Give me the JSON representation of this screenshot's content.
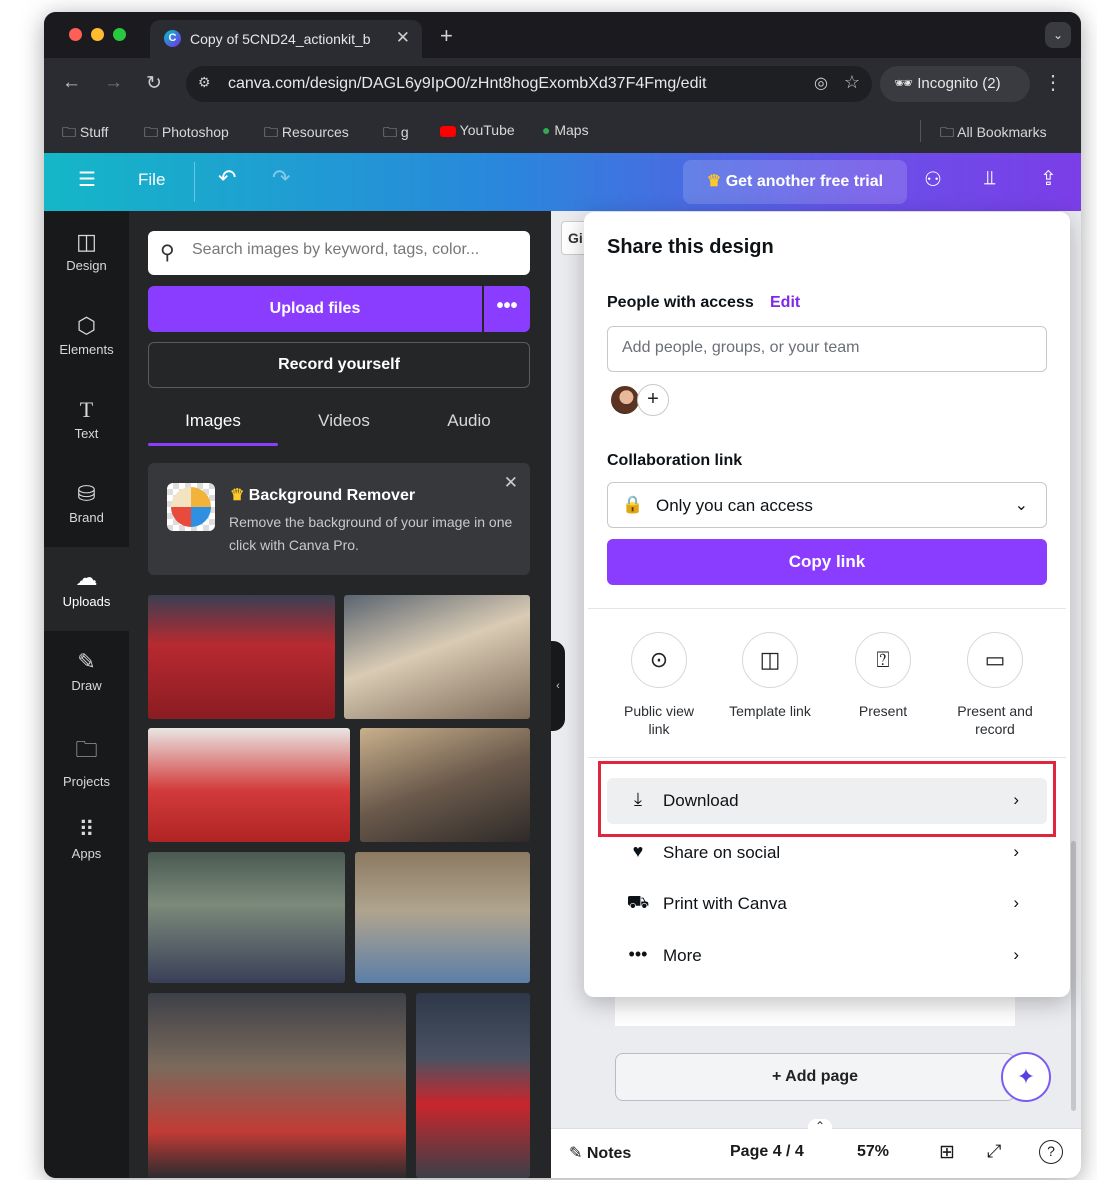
{
  "browser": {
    "tab_title": "Copy of 5CND24_actionkit_b",
    "tab_favicon": "C",
    "url": "canva.com/design/DAGL6y9IpO0/zHnt8hogExombXd37F4Fmg/edit",
    "incognito_label": "Incognito (2)",
    "bookmarks": [
      "Stuff",
      "Photoshop",
      "Resources",
      "g",
      "YouTube",
      "Maps"
    ],
    "all_bookmarks": "All Bookmarks"
  },
  "canva_bar": {
    "file_label": "File",
    "trial_label": "Get another free trial"
  },
  "rail": [
    {
      "label": "Design",
      "icon": "layout-icon"
    },
    {
      "label": "Elements",
      "icon": "shapes-icon"
    },
    {
      "label": "Text",
      "icon": "text-icon"
    },
    {
      "label": "Brand",
      "icon": "brand-icon"
    },
    {
      "label": "Uploads",
      "icon": "cloud-upload-icon"
    },
    {
      "label": "Draw",
      "icon": "draw-icon"
    },
    {
      "label": "Projects",
      "icon": "folder-icon"
    },
    {
      "label": "Apps",
      "icon": "apps-grid-icon"
    }
  ],
  "uploads_panel": {
    "search_placeholder": "Search images by keyword, tags, color...",
    "upload_label": "Upload files",
    "upload_more": "•••",
    "record_label": "Record yourself",
    "tabs": [
      "Images",
      "Videos",
      "Audio"
    ],
    "active_tab": "Images",
    "promo_title": "Background Remover",
    "promo_desc": "Remove the background of your image in one click with Canva Pro."
  },
  "canvas": {
    "page_tab_stub": "Gi",
    "add_page_label": "+ Add page",
    "notes_label": "Notes",
    "page_label": "Page 4 / 4",
    "zoom_label": "57%"
  },
  "share": {
    "title": "Share this design",
    "people_label": "People with access",
    "edit_label": "Edit",
    "add_people_placeholder": "Add people, groups, or your team",
    "collab_label": "Collaboration link",
    "access_value": "Only you can access",
    "copy_link_label": "Copy link",
    "options": [
      {
        "label": "Public view link",
        "icon": "link-icon"
      },
      {
        "label": "Template link",
        "icon": "template-icon"
      },
      {
        "label": "Present",
        "icon": "present-icon"
      },
      {
        "label": "Present and record",
        "icon": "camera-icon"
      }
    ],
    "rows": [
      {
        "label": "Download",
        "icon": "download-icon"
      },
      {
        "label": "Share on social",
        "icon": "heart-icon"
      },
      {
        "label": "Print with Canva",
        "icon": "truck-icon"
      },
      {
        "label": "More",
        "icon": "more-icon"
      }
    ]
  },
  "colors": {
    "canva_purple": "#8b3dff",
    "highlight_red": "#e0263f"
  }
}
